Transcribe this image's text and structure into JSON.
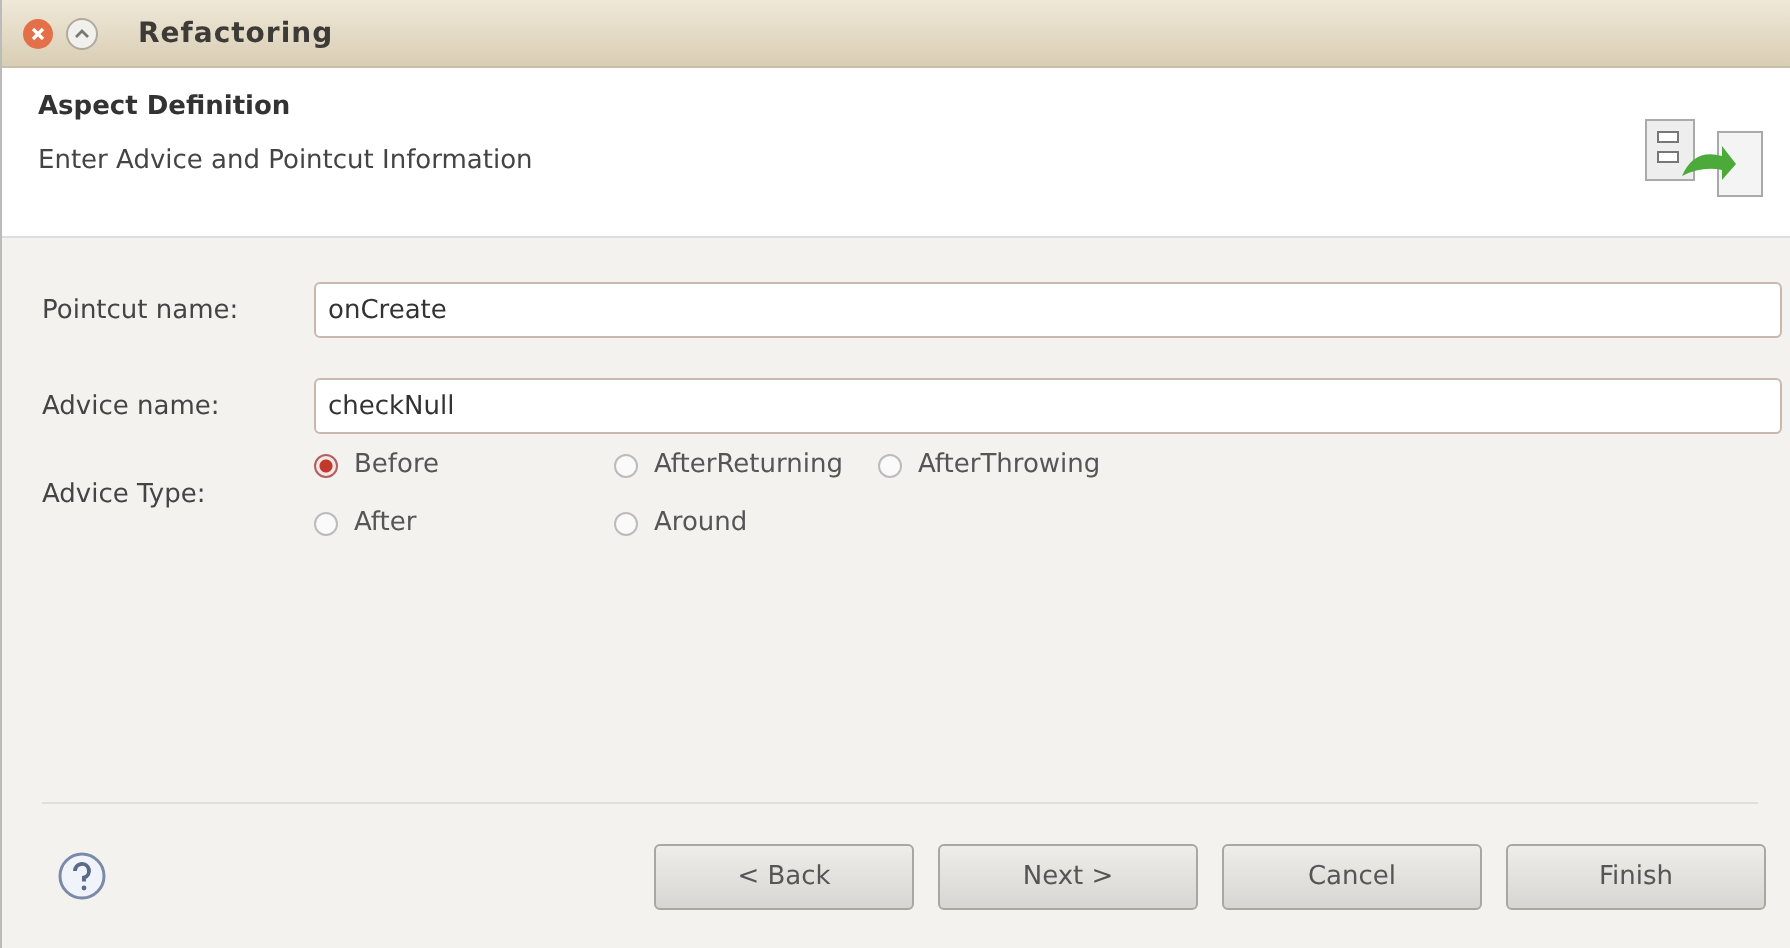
{
  "window": {
    "title": "Refactoring"
  },
  "header": {
    "title": "Aspect Definition",
    "description": "Enter Advice and Pointcut Information"
  },
  "fields": [
    {
      "label": "Pointcut name:",
      "value": "onCreate"
    },
    {
      "label": "Advice name:",
      "value": "checkNull"
    }
  ],
  "advice_type": {
    "label": "Advice Type:",
    "options": [
      {
        "label": "Before",
        "selected": true
      },
      {
        "label": "AfterReturning",
        "selected": false
      },
      {
        "label": "AfterThrowing",
        "selected": false
      },
      {
        "label": "After",
        "selected": false
      },
      {
        "label": "Around",
        "selected": false
      }
    ]
  },
  "buttons": [
    "< Back",
    "Next >",
    "Cancel",
    "Finish"
  ]
}
